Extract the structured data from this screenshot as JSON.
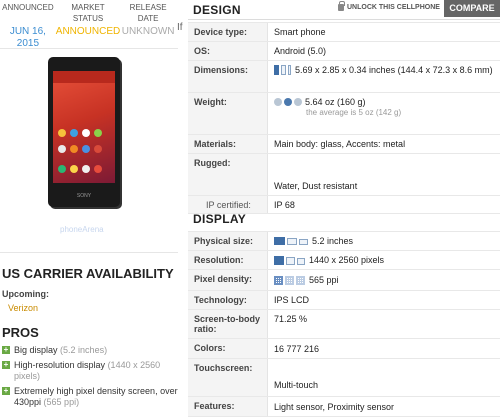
{
  "meta": {
    "columns": [
      {
        "header": "ANNOUNCED",
        "value": "JUN 16, 2015",
        "style": "date"
      },
      {
        "header": "MARKET STATUS",
        "value": "ANNOUNCED",
        "style": "ann"
      },
      {
        "header": "RELEASE DATE",
        "value": "UNKNOWN",
        "style": "unk"
      }
    ]
  },
  "photo": {
    "brand": "SONY",
    "watermark": "phoneArena"
  },
  "stray_char": "If",
  "carrier": {
    "title": "US CARRIER AVAILABILITY",
    "upcoming_label": "Upcoming:",
    "upcoming_value": "Verizon"
  },
  "pros": {
    "title": "PROS",
    "items": [
      {
        "text": "Big display",
        "note": "(5.2 inches)"
      },
      {
        "text": "High-resolution display",
        "note": "(1440 x 2560 pixels)"
      },
      {
        "text": "Extremely high pixel density screen, over 430ppi",
        "note": "(565 ppi)"
      }
    ]
  },
  "toolbar": {
    "unlock_label": "UNLOCK THIS CELLPHONE",
    "compare_label": "COMPARE"
  },
  "design": {
    "title": "DESIGN",
    "device_type": {
      "label": "Device type:",
      "value": "Smart phone"
    },
    "os": {
      "label": "OS:",
      "value": "Android (5.0)"
    },
    "dimensions": {
      "label": "Dimensions:",
      "value": "5.69 x 2.85 x 0.34 inches (144.4 x 72.3 x 8.6 mm)"
    },
    "weight": {
      "label": "Weight:",
      "value": "5.64 oz (160 g)",
      "note": "the average is 5 oz (142 g)"
    },
    "materials": {
      "label": "Materials:",
      "value": "Main body: glass, Accents: metal"
    },
    "rugged": {
      "label": "Rugged:",
      "value": "Water, Dust resistant"
    },
    "ip": {
      "label": "IP certified:",
      "value": "IP 68"
    }
  },
  "display": {
    "title": "DISPLAY",
    "physical_size": {
      "label": "Physical size:",
      "value": "5.2 inches"
    },
    "resolution": {
      "label": "Resolution:",
      "value": "1440 x 2560 pixels"
    },
    "pixel_density": {
      "label": "Pixel density:",
      "value": "565 ppi"
    },
    "technology": {
      "label": "Technology:",
      "value": "IPS LCD"
    },
    "screen_ratio": {
      "label": "Screen-to-body ratio:",
      "value": "71.25 %"
    },
    "colors": {
      "label": "Colors:",
      "value": "16 777 216"
    },
    "touchscreen": {
      "label": "Touchscreen:",
      "value": "Multi-touch"
    },
    "features": {
      "label": "Features:",
      "value": "Light sensor, Proximity sensor"
    }
  },
  "colors": {
    "accent_blue": "#3b8dd1",
    "announced_yellow": "#f0b400",
    "pro_green": "#6aa944",
    "compare_bg": "#666666"
  }
}
